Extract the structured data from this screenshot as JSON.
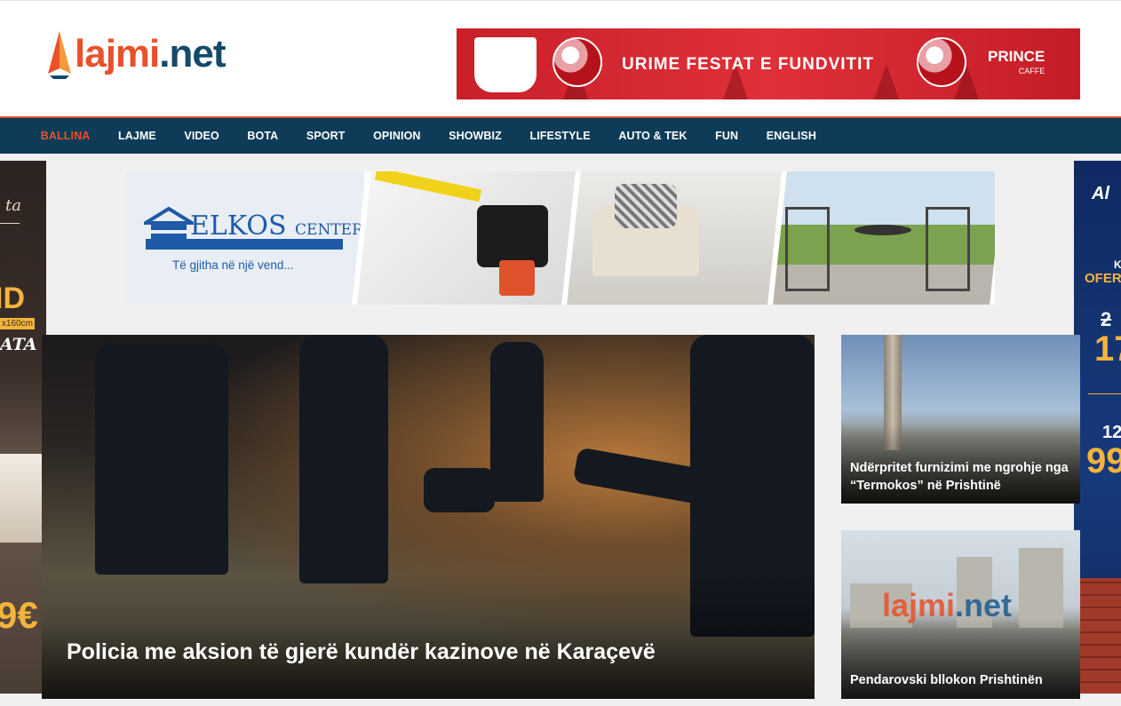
{
  "site": {
    "logo_part1": "lajmi",
    "logo_part2": ".net"
  },
  "top_banner": {
    "text": "URIME FESTAT E FUNDVITIT",
    "brand": "PRINCE",
    "brand_sub": "CAFFE"
  },
  "nav": {
    "items": [
      "BALLINA",
      "LAJME",
      "VIDEO",
      "BOTA",
      "SPORT",
      "OPINION",
      "SHOWBIZ",
      "LIFESTYLE",
      "AUTO & TEK",
      "FUN",
      "ENGLISH"
    ],
    "active": "BALLINA"
  },
  "left_ad": {
    "script_text": "ta",
    "headline": "ID",
    "size_tag": "x160cm",
    "brand": "ATA",
    "price": "9€"
  },
  "right_ad": {
    "logo": "Al",
    "k": "K",
    "offer": "OFER",
    "old_price": "2",
    "new_price": "17",
    "old_price2": "12",
    "new_price2": "99"
  },
  "mid_banner": {
    "brand": "ELKOS",
    "brand_sub": "CENTER",
    "tagline": "Të gjitha në një vend..."
  },
  "main_story": {
    "title": "Policia me aksion të gjerë kundër kazinove në Karaçevë"
  },
  "side_stories": [
    {
      "title": "Ndërpritet furnizimi me ngrohje nga “Termokos” në Prishtinë"
    },
    {
      "title": "Pendarovski bllokon Prishtinën"
    }
  ],
  "colors": {
    "brand_orange": "#e8512a",
    "brand_blue": "#14496b",
    "nav_bg": "#0e3b57"
  }
}
